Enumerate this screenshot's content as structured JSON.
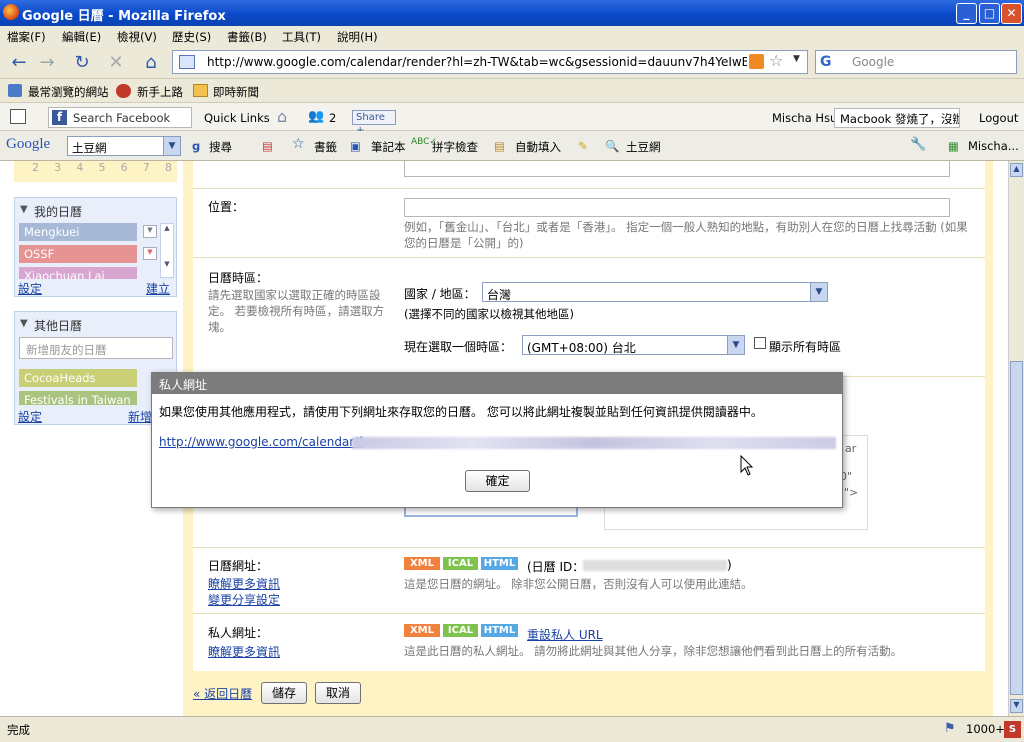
{
  "window": {
    "title": "Google 日曆 - Mozilla Firefox",
    "min": "_",
    "max": "□",
    "close": "✕"
  },
  "menu": [
    "檔案(F)",
    "編輯(E)",
    "檢視(V)",
    "歷史(S)",
    "書籤(B)",
    "工具(T)",
    "說明(H)"
  ],
  "nav": {
    "url": "http://www.google.com/calendar/render?hl=zh-TW&tab=wc&gsessionid=dauunv7h4YeIwBj-f",
    "search_placeholder": "Google"
  },
  "bookmarks": [
    "最常瀏覽的網站",
    "新手上路",
    "即時新聞"
  ],
  "fb": {
    "search_placeholder": "Search Facebook",
    "quick_links": "Quick Links",
    "friend_count": "2",
    "share": "Share",
    "user": "Mischa Hsu",
    "status": "Macbook 發燒了，沒辦法",
    "logout": "Logout"
  },
  "gbar": {
    "logo": "Google",
    "query": "土豆網",
    "search": "搜尋",
    "bookmarks": "書籤",
    "notebook": "筆記本",
    "spell": "拼字檢查",
    "autofill": "自動填入",
    "tudou": "土豆網",
    "user": "Mischa..."
  },
  "mini_cal_row": [
    "2",
    "3",
    "4",
    "5",
    "6",
    "7",
    "8"
  ],
  "sidebar": {
    "my_cals_title": "我的日曆",
    "my_cals": [
      {
        "name": "Mengkuei",
        "color": "#a7b9d6"
      },
      {
        "name": "OSSF",
        "color": "#e69393"
      },
      {
        "name": "Xiaochuan Lai",
        "color": "#d8a6d0"
      }
    ],
    "settings": "設定",
    "create": "建立",
    "other_cals_title": "其他日曆",
    "add_friend_placeholder": "新增朋友的日曆",
    "other_cals": [
      {
        "name": "CocoaHeads",
        "color": "#c9cf74"
      },
      {
        "name": "Festivals in Taiwan",
        "color": "#a9c47f"
      }
    ],
    "settings2": "設定",
    "add": "新增"
  },
  "form": {
    "location_label": "位置：",
    "location_hint": "例如，「舊金山」、「台北」或者是「香港」。 指定一個一般人熟知的地點，有助別人在您的日曆上找尋活動 (如果您的日曆是「公開」的)",
    "tz_label": "日曆時區：",
    "tz_hint": "請先選取國家以選取正確的時區設定。 若要檢視所有時區，請選取方塊。",
    "country_label": "國家 / 地區：",
    "country_value": "台灣",
    "country_hint": "(選擇不同的國家以檢視其他地區)",
    "tz_select_label": "現在選取一個時區：",
    "tz_value": "(GMT+08:00) 台北",
    "show_all_tz": "顯示所有時區",
    "cal_address_label": "日曆網址：",
    "learn_more": "瞭解更多資訊",
    "change_share": "變更分享設定",
    "cal_id_prefix": "(日曆 ID：",
    "cal_id_suffix": ")",
    "cal_address_hint": "這是您日曆的網址。 除非您公開日曆，否則沒有人可以使用此連結。",
    "private_label": "私人網址：",
    "learn_more2": "瞭解更多資訊",
    "reset_private": "重設私人 URL",
    "private_hint": "這是此日曆的私人網址。 請勿將此網址與其他人分享，除非您想讓他們看到此日曆上的所有活動。",
    "tags": [
      "XML",
      "ICAL",
      "HTML"
    ],
    "back": "« 返回日曆",
    "save": "儲存",
    "cancel": "取消",
    "embed_fragments": [
      "ar",
      "0\"",
      "\">"
    ]
  },
  "dialog": {
    "title": "私人網址",
    "message": "如果您使用其他應用程式，請使用下列網址來存取您的日曆。 您可以將此網址複製並貼到任何資訊提供閱讀器中。",
    "url": "http://www.google.com/calendar/f",
    "ok": "確定"
  },
  "status": {
    "text": "完成",
    "count": "1000+"
  },
  "colors": {
    "xml": "#f1813f",
    "ical": "#7fc24e",
    "html": "#56a8e4",
    "link": "#1a42a5",
    "frame": "#fdf3c4"
  }
}
